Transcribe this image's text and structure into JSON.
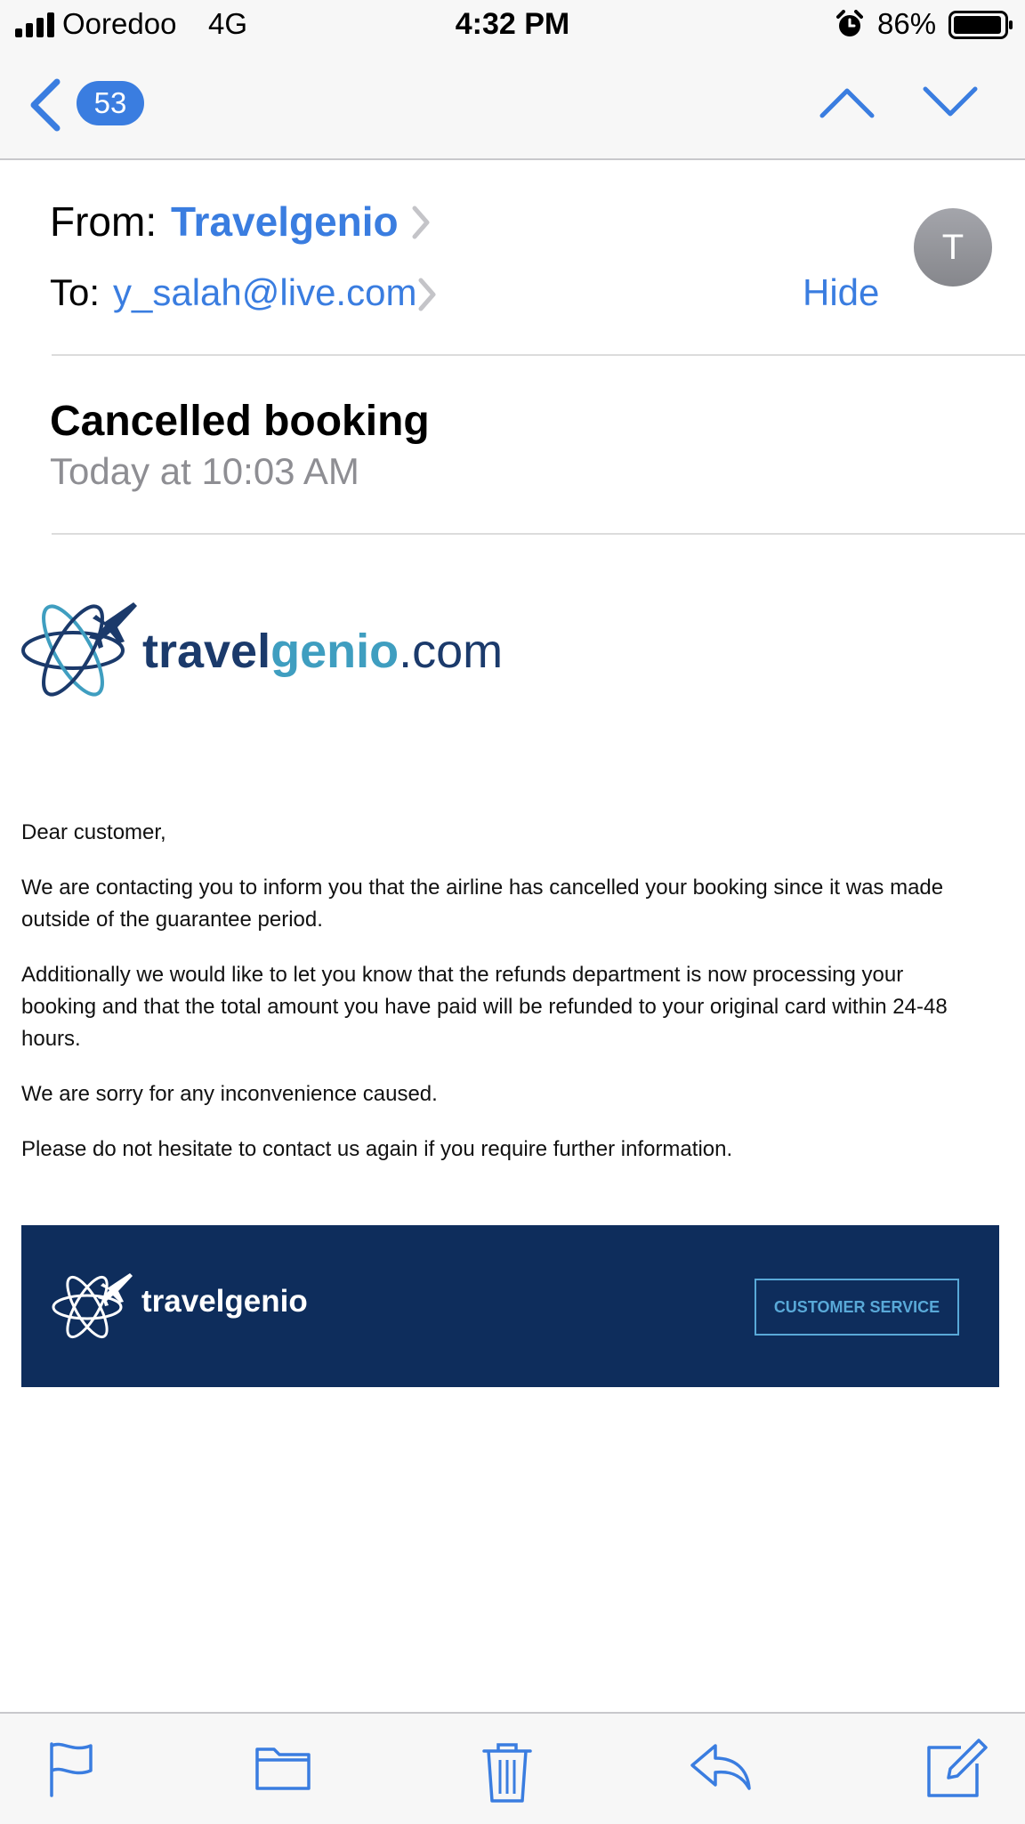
{
  "status_bar": {
    "carrier": "Ooredoo",
    "network": "4G",
    "time": "4:32 PM",
    "battery": "86%",
    "icons": [
      "signal-icon",
      "alarm-icon",
      "battery-icon"
    ]
  },
  "nav": {
    "unread_count": "53",
    "icons": [
      "back-chevron-icon",
      "up-chevron-icon",
      "down-chevron-icon"
    ]
  },
  "header": {
    "from_label": "From:",
    "from_name": "Travelgenio",
    "to_label": "To:",
    "to_address": "y_salah@live.com",
    "hide_label": "Hide",
    "avatar_initial": "T",
    "subject": "Cancelled booking",
    "date": "Today at 10:03 AM"
  },
  "logo": {
    "part1": "travel",
    "part2": "genio",
    "part3": ".com"
  },
  "body": {
    "greeting": "Dear customer,",
    "p1": "We are contacting you to inform you that the airline has cancelled your booking since it was made outside of the guarantee period.",
    "p2": "Additionally we would like to let you know that the refunds department is now processing your booking and that the total amount you have paid will be refunded to your original card within 24-48 hours.",
    "p3": "We are sorry for any inconvenience caused.",
    "p4": "Please do not hesitate to contact us again if you require further information."
  },
  "banner": {
    "brand": "travelgenio",
    "button_label": "CUSTOMER SERVICE"
  },
  "toolbar": {
    "icons": [
      "flag-icon",
      "folder-icon",
      "trash-icon",
      "reply-icon",
      "compose-icon"
    ]
  },
  "colors": {
    "accent": "#3a7de0",
    "banner_bg": "#0e2d5c",
    "banner_button": "#59a9d8",
    "logo_dark": "#1b3a6b",
    "logo_teal": "#3f9ec0",
    "secondary_text": "#8e8e93"
  }
}
